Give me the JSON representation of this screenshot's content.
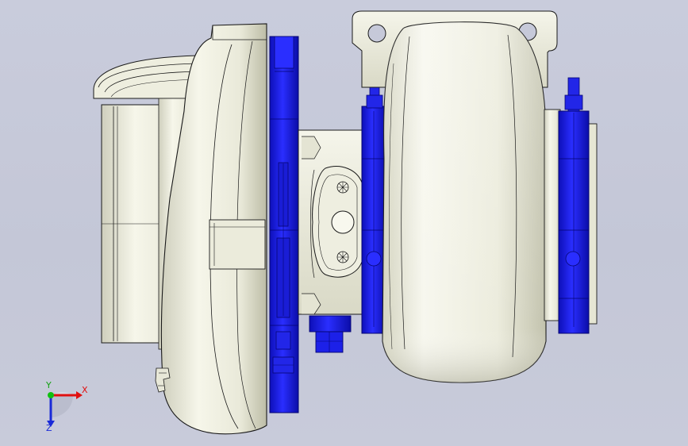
{
  "viewport": {
    "background": "#c6c9d9",
    "view": "turbocharger-assembly-front-view"
  },
  "colors": {
    "body": "#ededdf",
    "body_shade": "#c9c9b4",
    "edge": "#1a1a1a",
    "clamp_blue": "#1f22ff",
    "clamp_dark": "#0c0c9a"
  },
  "triad": {
    "x_label": "X",
    "y_label": "Y",
    "z_label": "Z",
    "x_color": "#e01010",
    "y_color": "#10c010",
    "z_color": "#1a2ad8"
  }
}
